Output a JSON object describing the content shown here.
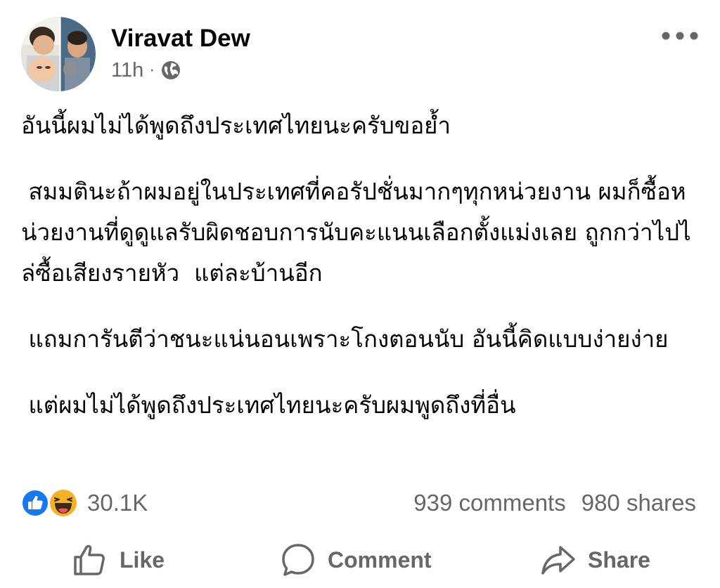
{
  "post": {
    "author_name": "Viravat Dew",
    "timestamp": "11h",
    "separator": "·",
    "privacy_icon": "globe-icon",
    "paragraphs": [
      "อันนี้ผมไม่ได้พูดถึงประเทศไทยนะครับขอย้ำ",
      " สมมตินะถ้าผมอยู่ในประเทศที่คอรัปชั่นมากๆทุกหน่วยงาน ผมก็ซื้อหน่วยงานที่ดูดูแลรับผิดชอบการนับคะแนนเลือกตั้งแม่งเลย ถูกกว่าไปไล่ซื้อเสียงรายหัว  แต่ละบ้านอีก",
      " แถมการันตีว่าชนะแน่นอนเพราะโกงตอนนับ อันนี้คิดแบบง่ายง่าย",
      " แต่ผมไม่ได้พูดถึงประเทศไทยนะครับผมพูดถึงที่อื่น"
    ]
  },
  "reactions": {
    "icons": [
      "like-reaction-icon",
      "haha-reaction-icon"
    ],
    "count": "30.1K"
  },
  "engagement": {
    "comments": "939 comments",
    "shares": "980 shares"
  },
  "actions": {
    "like_label": "Like",
    "comment_label": "Comment",
    "share_label": "Share"
  },
  "colors": {
    "text_primary": "#050505",
    "text_secondary": "#65676b",
    "like_blue": "#1877f2",
    "haha_yellow": "#f7b125"
  }
}
